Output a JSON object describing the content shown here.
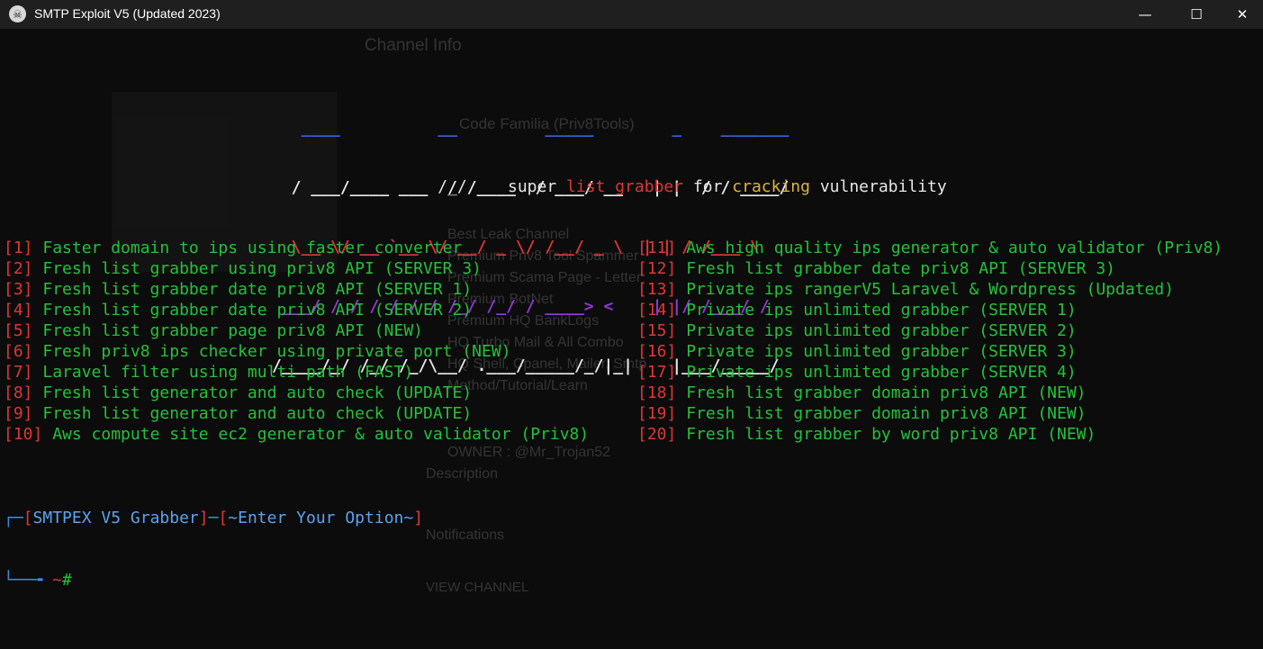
{
  "window": {
    "title": "SMTP Exploit V5 (Updated 2023)",
    "controls": {
      "minimize": "—",
      "maximize": "☐",
      "close": "✕"
    }
  },
  "banner": {
    "line1": "   ____          __         _____        _    _______",
    "line2": "  / ___/____ ___  / /____  / ___/ __   | |  / / ____/",
    "line3": "  \\__ \\/ __ `__ \\/ __/ _ \\/ /__/ _ \\  | | / /___ \\",
    "line4": " ___/ / / / / / / /_/ /_/ / ____> <    | |/ /___/ /",
    "line5": "/____/_/ /_/ /_/\\__/ .___/_____/_/|_|    |___/_____/",
    "line6": "                 /_/"
  },
  "tagline": {
    "w1": "super ",
    "r1": "list grabber ",
    "w2": "for ",
    "y1": "cracking ",
    "w3": "vulnerability"
  },
  "menu_left": [
    {
      "num": "[1]",
      "text": " Faster domain to ips using faster converter"
    },
    {
      "num": "[2]",
      "text": " Fresh list grabber using priv8 API (SERVER 3)"
    },
    {
      "num": "[3]",
      "text": " Fresh list grabber date priv8 API (SERVER 1)"
    },
    {
      "num": "[4]",
      "text": " Fresh list grabber date priv8 API (SERVER 2)"
    },
    {
      "num": "[5]",
      "text": " Fresh list grabber page priv8 API (NEW)"
    },
    {
      "num": "[6]",
      "text": " Fresh priv8 ips checker using private port (NEW)"
    },
    {
      "num": "[7]",
      "text": " Laravel filter using multi path (FAST)"
    },
    {
      "num": "[8]",
      "text": " Fresh list generator and auto check (UPDATE)"
    },
    {
      "num": "[9]",
      "text": " Fresh list generator and auto check (UPDATE)"
    },
    {
      "num": "[10]",
      "text": " Aws compute site ec2 generator & auto validator (Priv8)"
    }
  ],
  "menu_right": [
    {
      "num": "[11]",
      "text": " Aws high quality ips generator & auto validator (Priv8)"
    },
    {
      "num": "[12]",
      "text": " Fresh list grabber date priv8 API (SERVER 3)"
    },
    {
      "num": "[13]",
      "text": " Private ips rangerV5 Laravel & Wordpress (Updated)"
    },
    {
      "num": "[14]",
      "text": " Private ips unlimited grabber (SERVER 1)"
    },
    {
      "num": "[15]",
      "text": " Private ips unlimited grabber (SERVER 2)"
    },
    {
      "num": "[16]",
      "text": " Private ips unlimited grabber (SERVER 3)"
    },
    {
      "num": "[17]",
      "text": " Private ips unlimited grabber (SERVER 4)"
    },
    {
      "num": "[18]",
      "text": " Fresh list grabber domain priv8 API (NEW)"
    },
    {
      "num": "[19]",
      "text": " Fresh list grabber domain priv8 API (NEW)"
    },
    {
      "num": "[20]",
      "text": " Fresh list grabber by word priv8 API (NEW)"
    }
  ],
  "prompt": {
    "corner_top": "┌─",
    "open1": "[",
    "label1": "SMTPEX V5 Grabber",
    "close1": "]",
    "dash": "─",
    "open2": "[",
    "label2": "~Enter Your Option~",
    "close2": "]",
    "corner_bottom": "└──╼ ",
    "cwd": "~",
    "hash": "#"
  },
  "background_window": {
    "channel_info": "Channel Info",
    "channel_name": "Code Familia (Priv8Tools)",
    "list": [
      "Best Leak Channel",
      "Premium Priv8 Tool Spammer",
      "Premium Scama Page - Letter",
      "Premium BotNet",
      "Premium HQ BankLogs",
      "HQ Turbo Mail & All Combo",
      "HQ Shell, Cpanel, Mailer, Smtp",
      "Method/Tutorial/Learn"
    ],
    "owner": "OWNER : @Mr_Trojan52",
    "description": "Description",
    "notifications": "Notifications",
    "view_channel": "VIEW CHANNEL"
  },
  "colors": {
    "red": "#e03636",
    "green": "#23c23a",
    "blue": "#5aa3f0",
    "purple": "#8f3bd6",
    "yellow": "#e0b43a"
  }
}
